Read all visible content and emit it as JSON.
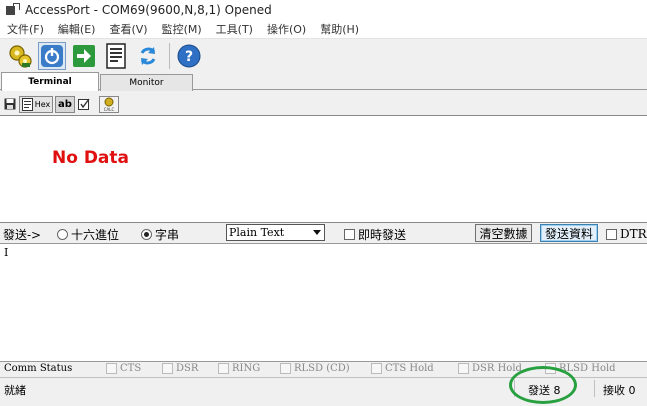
{
  "window": {
    "title": "AccessPort - COM69(9600,N,8,1) Opened"
  },
  "menu": [
    "文件(F)",
    "編輯(E)",
    "查看(V)",
    "監控(M)",
    "工具(T)",
    "操作(O)",
    "幫助(H)"
  ],
  "toolbar": {
    "icons": [
      "serial-gear-icon",
      "power-icon",
      "arrow-right-icon",
      "document-icon",
      "refresh-icon",
      "help-icon"
    ]
  },
  "tabs": [
    {
      "label": "Terminal",
      "active": true
    },
    {
      "label": "Monitor",
      "active": false
    }
  ],
  "subtoolbar": {
    "hex_label": "Hex",
    "ab_label": "ab",
    "calc_label": "CALC"
  },
  "receive": {
    "placeholder": "No Data",
    "color": "#e01010"
  },
  "send_options": {
    "send_label": "發送->",
    "radio_hex": "十六進位",
    "radio_char": "字串",
    "format_value": "Plain Text",
    "realtime_label": "即時發送",
    "clear_button": "清空數據",
    "send_button": "發送資料",
    "dtr_label": "DTR"
  },
  "send_area": {
    "text": "I"
  },
  "comm_status": {
    "label": "Comm Status",
    "signals": [
      "CTS",
      "DSR",
      "RING",
      "RLSD (CD)",
      "CTS Hold",
      "DSR Hold",
      "RLSD Hold"
    ]
  },
  "status_bar": {
    "ready": "就緒",
    "sent": "發送 8",
    "received": "接收 0"
  }
}
